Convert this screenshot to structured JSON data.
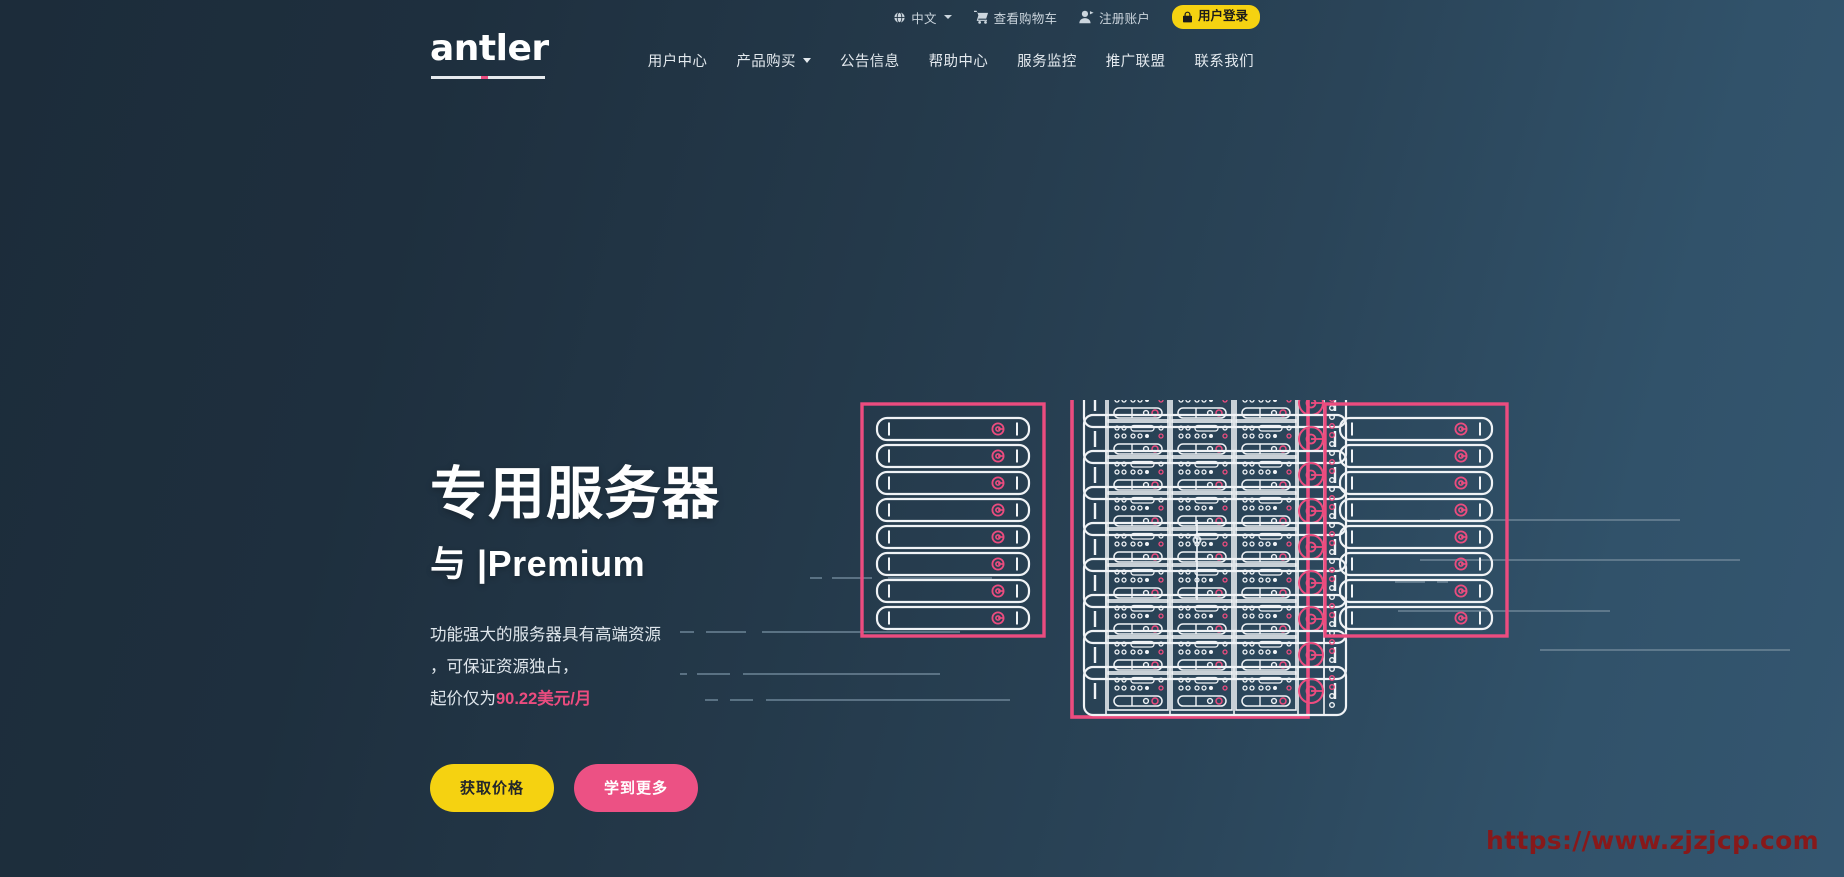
{
  "brand": {
    "name": "antler"
  },
  "topbar": {
    "language": {
      "label": "中文",
      "icon": "globe-icon",
      "caret": "chevron-down-icon"
    },
    "cart": {
      "label": "查看购物车",
      "icon": "shopping-cart-icon"
    },
    "register": {
      "label": "注册账户",
      "icon": "user-add-icon"
    },
    "login": {
      "label": "用户登录",
      "icon": "lock-icon",
      "background": "#f5d211",
      "text_color": "#1b1b1b"
    }
  },
  "nav": {
    "items": [
      {
        "label": "用户中心",
        "has_dropdown": false
      },
      {
        "label": "产品购买",
        "has_dropdown": true
      },
      {
        "label": "公告信息",
        "has_dropdown": false
      },
      {
        "label": "帮助中心",
        "has_dropdown": false
      },
      {
        "label": "服务监控",
        "has_dropdown": false
      },
      {
        "label": "推广联盟",
        "has_dropdown": false
      },
      {
        "label": "联系我们",
        "has_dropdown": false
      }
    ]
  },
  "hero": {
    "title": "专用服务器",
    "subtitle": "与 |Premium",
    "desc_line1": "功能强大的服务器具有高端资源",
    "desc_line2": "，可保证资源独占，",
    "desc_line3_prefix": "起价仅为",
    "price": "90.22美元/月",
    "primary_button": "获取价格",
    "secondary_button": "学到更多"
  },
  "watermark": {
    "text": "https://www.zjzjcp.com",
    "color": "#8c1616"
  },
  "theme": {
    "bg_left": "#1c2c3a",
    "bg_right": "#345670",
    "accent_pink": "#ec4c7f",
    "accent_yellow": "#f5d211",
    "text_light": "#e3e9ee"
  },
  "illustration": {
    "name": "server-racks-illustration",
    "racks": [
      {
        "id": "left-rack",
        "units": 8,
        "style": "simple"
      },
      {
        "id": "center-rack",
        "units": 9,
        "style": "detailed"
      },
      {
        "id": "right-rack",
        "units": 8,
        "style": "simple"
      }
    ]
  }
}
